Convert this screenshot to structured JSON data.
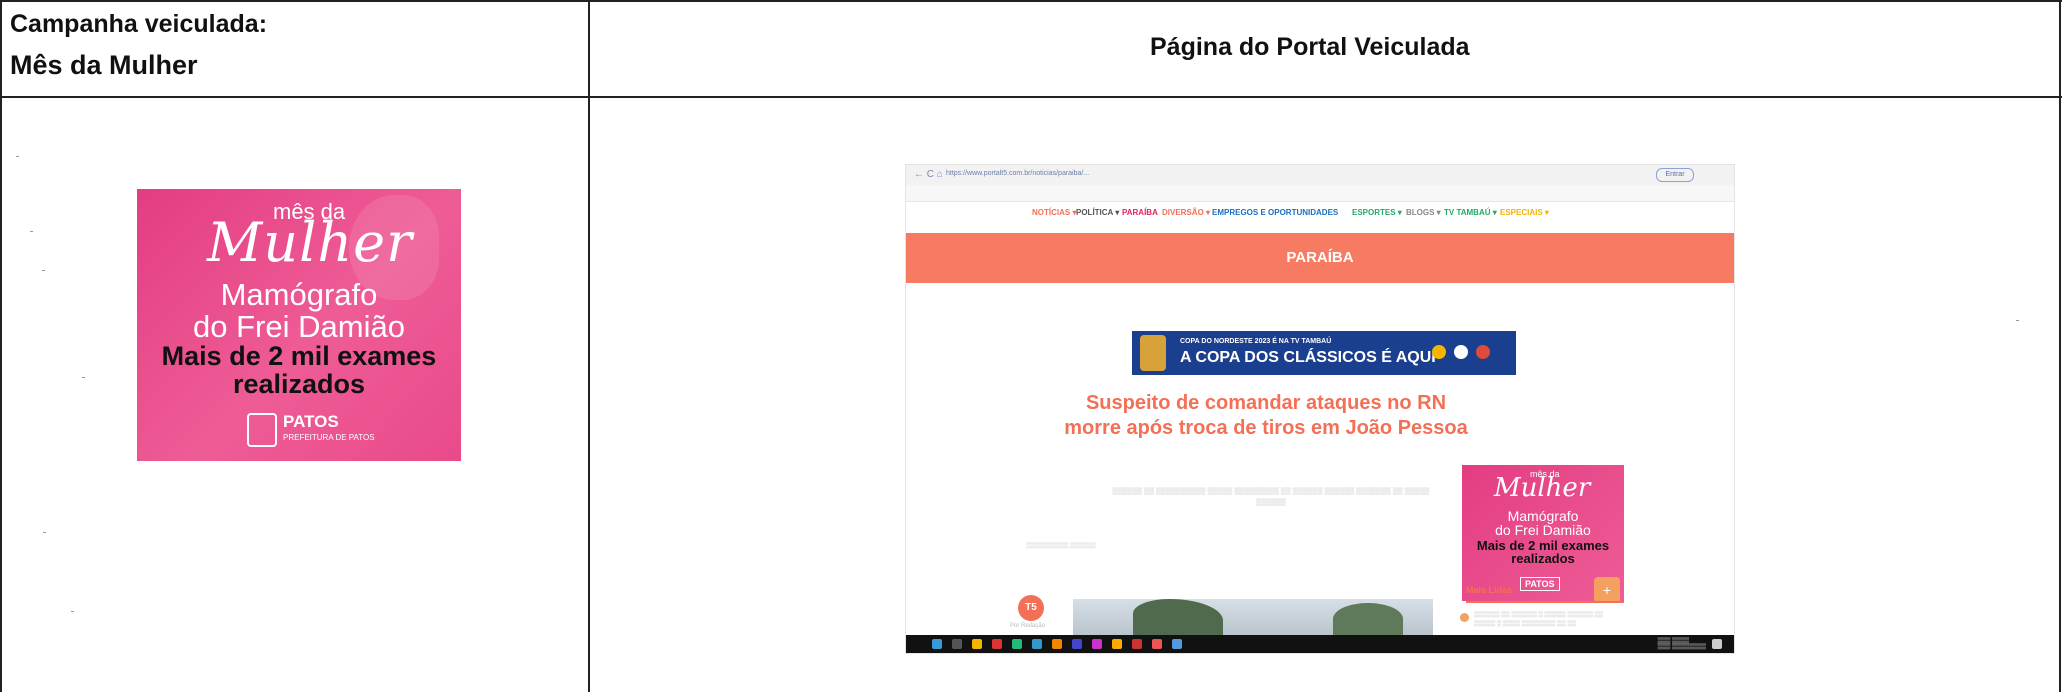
{
  "table": {
    "left_header_line1": "Campanha veiculada:",
    "left_header_line2": "Mês da Mulher",
    "right_header": "Página do Portal Veiculada"
  },
  "banner": {
    "mes_da": "mês da",
    "mulher_script": "Mulher",
    "title_line1": "Mamógrafo",
    "title_line2": "do Frei Damião",
    "subtitle_line1": "Mais de 2 mil exames",
    "subtitle_line2": "realizados",
    "logo_text": "PATOS",
    "logo_sub": "PREFEITURA DE PATOS",
    "colors": {
      "bg_start": "#e33d82",
      "bg_end": "#ee5c96",
      "text": "#ffffff",
      "subtitle": "#111111"
    }
  },
  "portal_screenshot": {
    "menu": [
      {
        "label": "NOTÍCIAS ▾",
        "color": "#f37056"
      },
      {
        "label": "POLÍTICA ▾",
        "color": "#555555"
      },
      {
        "label": "PARAÍBA",
        "color": "#e0245e"
      },
      {
        "label": "DIVERSÃO ▾",
        "color": "#f37056"
      },
      {
        "label": "EMPREGOS E OPORTUNIDADES",
        "color": "#1a6fc2"
      },
      {
        "label": "ESPORTES ▾",
        "color": "#22aa66"
      },
      {
        "label": "BLOGS ▾",
        "color": "#888888"
      },
      {
        "label": "TV TAMBAÚ ▾",
        "color": "#22aa66"
      },
      {
        "label": "ESPECIAIS ▾",
        "color": "#f4b400"
      }
    ],
    "section_title": "PARAÍBA",
    "ad_line1": "COPA DO NORDESTE 2023 É NA TV TAMBAÚ",
    "ad_line2": "A COPA DOS CLÁSSICOS É AQUI",
    "headline": "Suspeito de comandar ataques no RN morre após troca de tiros em João Pessoa",
    "mini_banner": {
      "mes_da": "mês da",
      "mulher_script": "Mulher",
      "title_line1": "Mamógrafo",
      "title_line2": "do Frei Damião",
      "subtitle_line1": "Mais de 2 mil exames",
      "subtitle_line2": "realizados",
      "logo_text": "PATOS"
    },
    "mais_lidas": "Mais Lidas",
    "plus": "+",
    "avatar_text": "T5",
    "author": "Por Redação"
  }
}
